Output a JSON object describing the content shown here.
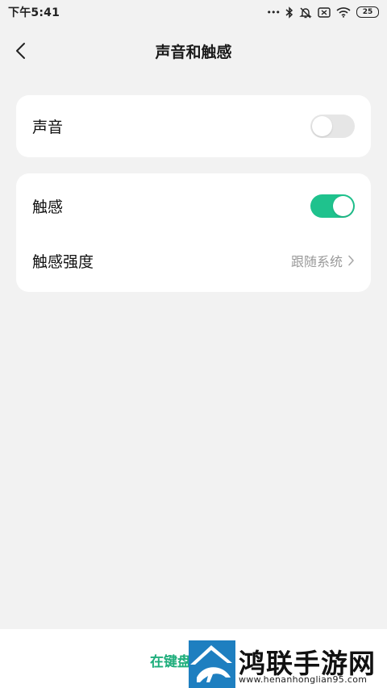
{
  "status_bar": {
    "time": "下午5:41",
    "dots": "•••",
    "battery": "25",
    "icons": [
      "more-dots-icon",
      "bluetooth-icon",
      "mute-icon",
      "sim-icon",
      "wifi-icon",
      "battery-icon"
    ]
  },
  "header": {
    "title": "声音和触感",
    "back_icon": "chevron-left-icon"
  },
  "sections": {
    "sound": {
      "label": "声音",
      "enabled": false
    },
    "haptic": {
      "label": "触感",
      "enabled": true
    },
    "haptic_strength": {
      "label": "触感强度",
      "value": "跟随系统",
      "icon": "chevron-right-icon"
    }
  },
  "bottom": {
    "link_text": "在键盘"
  },
  "watermark": {
    "title": "鸿联手游网",
    "url": "www.henanhonglian95.com"
  },
  "colors": {
    "accent": "#1fc28d",
    "background": "#f2f2f2",
    "card": "#ffffff",
    "toggle_off": "#e6e6e6",
    "secondary_text": "#9a9a9a"
  }
}
